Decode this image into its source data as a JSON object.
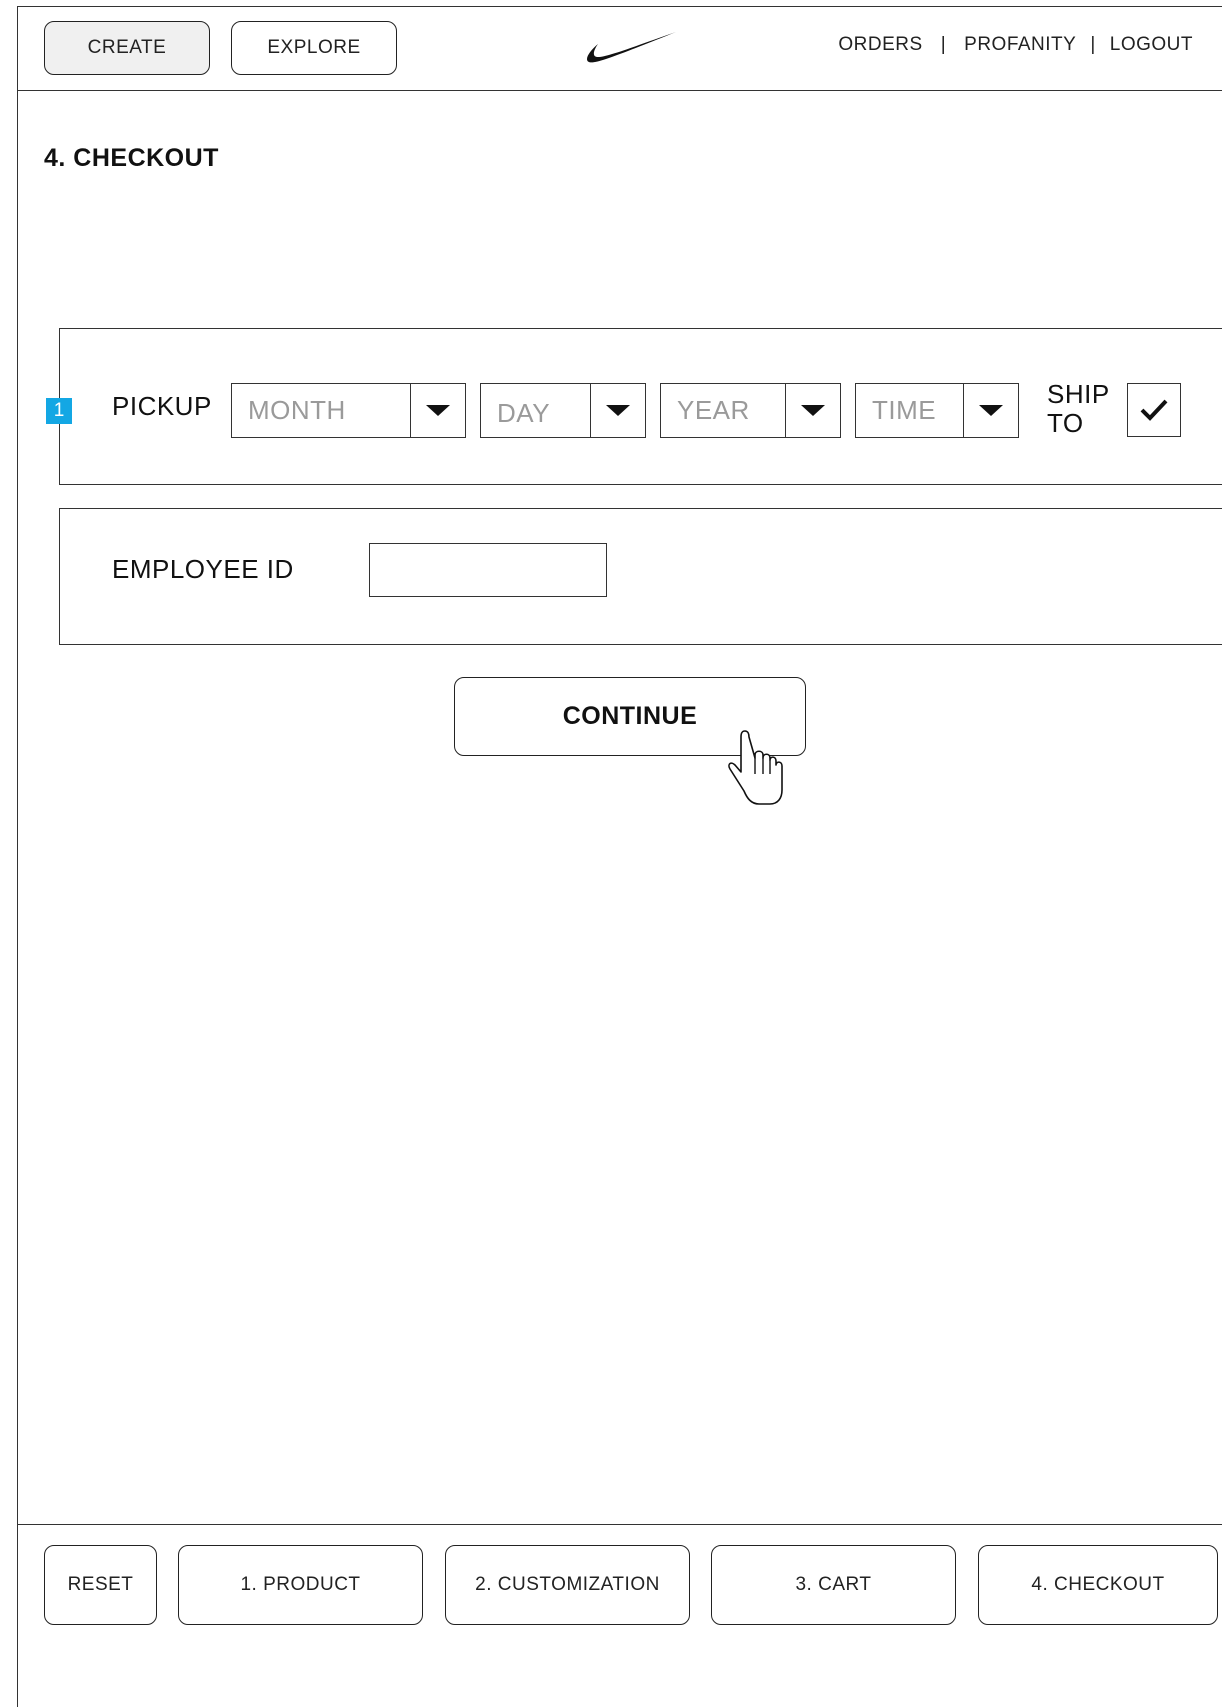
{
  "header": {
    "tabs": [
      {
        "label": "CREATE",
        "active": true
      },
      {
        "label": "EXPLORE",
        "active": false
      }
    ],
    "logo_icon": "nike-swoosh-icon",
    "user_nav": [
      {
        "label": "ORDERS"
      },
      {
        "label": "PROFANITY"
      },
      {
        "label": "LOGOUT"
      }
    ],
    "separator": "|"
  },
  "page_title": "4. CHECKOUT",
  "pickup": {
    "step_badge": "1",
    "label": "PICKUP",
    "month_placeholder": "MONTH",
    "day_placeholder": "DAY",
    "year_placeholder": "YEAR",
    "time_placeholder": "TIME",
    "ship_to_label_line1": "SHIP",
    "ship_to_label_line2": "TO",
    "ship_to_checked": true
  },
  "employee": {
    "label": "EMPLOYEE ID",
    "value": ""
  },
  "continue_label": "CONTINUE",
  "footer": {
    "reset_label": "RESET",
    "steps": [
      {
        "label": "1. PRODUCT"
      },
      {
        "label": "2. CUSTOMIZATION"
      },
      {
        "label": "3. CART"
      },
      {
        "label": "4. CHECKOUT"
      }
    ]
  },
  "colors": {
    "badge": "#13a7e4",
    "border": "#333333",
    "placeholder_text": "#9a9a9a"
  }
}
